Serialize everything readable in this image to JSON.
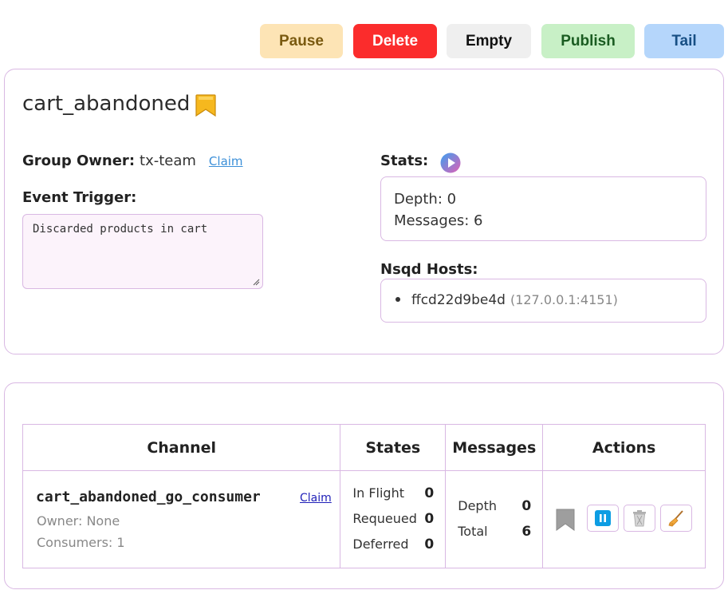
{
  "toolbar": {
    "pause_label": "Pause",
    "delete_label": "Delete",
    "empty_label": "Empty",
    "publish_label": "Publish",
    "tail_label": "Tail"
  },
  "topic": {
    "name": "cart_abandoned",
    "group_owner_label": "Group Owner:",
    "group_owner_value": "tx-team",
    "claim_label": "Claim",
    "event_trigger_label": "Event Trigger:",
    "event_trigger_value": "Discarded products in cart",
    "stats_label": "Stats:",
    "depth_text": "Depth: 0",
    "messages_text": "Messages: 6",
    "nsqd_label": "Nsqd Hosts:",
    "nsqd_hosts": [
      {
        "name": "ffcd22d9be4d",
        "address": "(127.0.0.1:4151)"
      }
    ]
  },
  "channels_table": {
    "headers": [
      "Channel",
      "States",
      "Messages",
      "Actions"
    ],
    "rows": [
      {
        "name": "cart_abandoned_go_consumer",
        "claim_label": "Claim",
        "owner_text": "Owner: None",
        "consumers_text": "Consumers: 1",
        "states": [
          {
            "label": "In Flight",
            "value": "0"
          },
          {
            "label": "Requeued",
            "value": "0"
          },
          {
            "label": "Deferred",
            "value": "0"
          }
        ],
        "messages": [
          {
            "label": "Depth",
            "value": "0"
          },
          {
            "label": "Total",
            "value": "6"
          }
        ]
      }
    ]
  },
  "icons": {
    "bookmark": "bookmark-icon",
    "play": "play-icon",
    "channel_bookmark": "bookmark-icon",
    "pause": "pause-icon",
    "delete": "trash-icon",
    "empty": "broom-icon"
  },
  "colors": {
    "pause_bg": "#fde4b5",
    "delete_bg": "#fb2c2c",
    "empty_bg": "#efefef",
    "publish_bg": "#c8f0c6",
    "tail_bg": "#b5d6fb",
    "border": "#d9b8e3",
    "bookmark": "#f4b400"
  }
}
